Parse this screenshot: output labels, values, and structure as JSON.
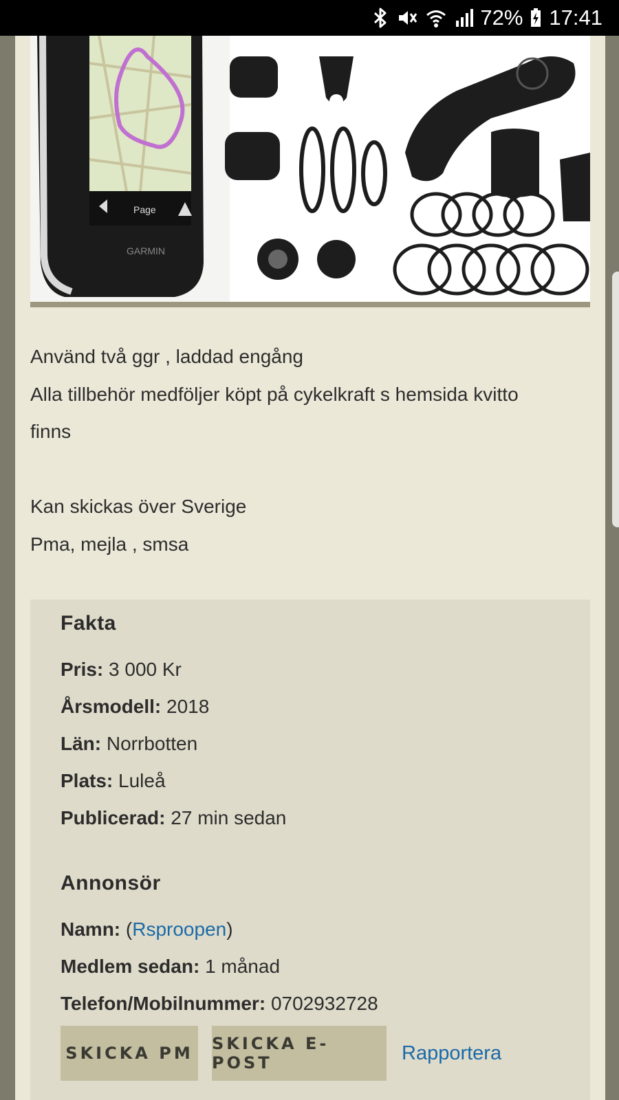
{
  "status_bar": {
    "battery_percent": "72%",
    "time": "17:41"
  },
  "description": {
    "lines": [
      "Använd två ggr , laddad engång",
      "Alla tillbehör medföljer köpt på cykelkraft s hemsida kvitto",
      "finns",
      "Kan skickas över Sverige",
      "Pma, mejla , smsa"
    ]
  },
  "facts": {
    "title": "Fakta",
    "price_label": "Pris:",
    "price_value": "3 000 Kr",
    "year_label": "Årsmodell:",
    "year_value": "2018",
    "county_label": "Län:",
    "county_value": "Norrbotten",
    "place_label": "Plats:",
    "place_value": "Luleå",
    "published_label": "Publicerad:",
    "published_value": "27 min sedan"
  },
  "advertiser": {
    "title": "Annonsör",
    "name_label": "Namn:",
    "name_open": "(",
    "name_value": "Rsproopen",
    "name_close": ")",
    "member_label": "Medlem sedan:",
    "member_value": "1 månad",
    "phone_label": "Telefon/Mobilnummer:",
    "phone_value": "0702932728"
  },
  "actions": {
    "send_pm": "SKICKA PM",
    "send_email": "SKICKA E-POST",
    "report": "Rapportera"
  },
  "colors": {
    "page_bg": "#ece8d8",
    "box_bg": "#dfdbca",
    "button_bg": "#c3bea0",
    "link": "#1a6aa8"
  },
  "icons": {
    "bluetooth": "bluetooth-icon",
    "mute": "vibrate-mute-icon",
    "wifi": "wifi-icon",
    "signal": "signal-icon",
    "battery": "battery-icon"
  }
}
